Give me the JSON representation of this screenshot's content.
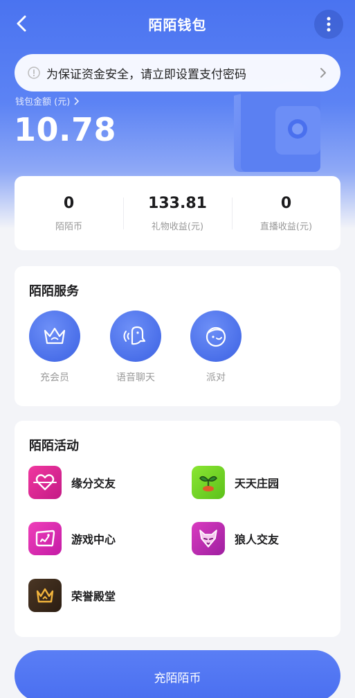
{
  "header": {
    "title": "陌陌钱包"
  },
  "notice": {
    "text": "为保证资金安全，请立即设置支付密码"
  },
  "balance": {
    "label": "钱包金额 (元)",
    "amount": "10.78"
  },
  "stats": [
    {
      "value": "0",
      "label": "陌陌币"
    },
    {
      "value": "133.81",
      "label": "礼物收益(元)"
    },
    {
      "value": "0",
      "label": "直播收益(元)"
    }
  ],
  "services": {
    "title": "陌陌服务",
    "items": [
      {
        "label": "充会员",
        "icon": "crown-icon"
      },
      {
        "label": "语音聊天",
        "icon": "voice-chat-icon"
      },
      {
        "label": "派对",
        "icon": "party-icon"
      }
    ]
  },
  "activities": {
    "title": "陌陌活动",
    "items": [
      {
        "label": "缘分交友",
        "icon": "heart-icon",
        "color": "#e0259b"
      },
      {
        "label": "天天庄园",
        "icon": "sprout-icon",
        "color": "#7ed321"
      },
      {
        "label": "游戏中心",
        "icon": "game-icon",
        "color": "#d62ab8"
      },
      {
        "label": "狼人交友",
        "icon": "wolf-icon",
        "color": "#c42ab0"
      },
      {
        "label": "荣誉殿堂",
        "icon": "crown-icon",
        "color": "#3a2a1e"
      }
    ]
  },
  "cta": {
    "label": "充陌陌币"
  }
}
